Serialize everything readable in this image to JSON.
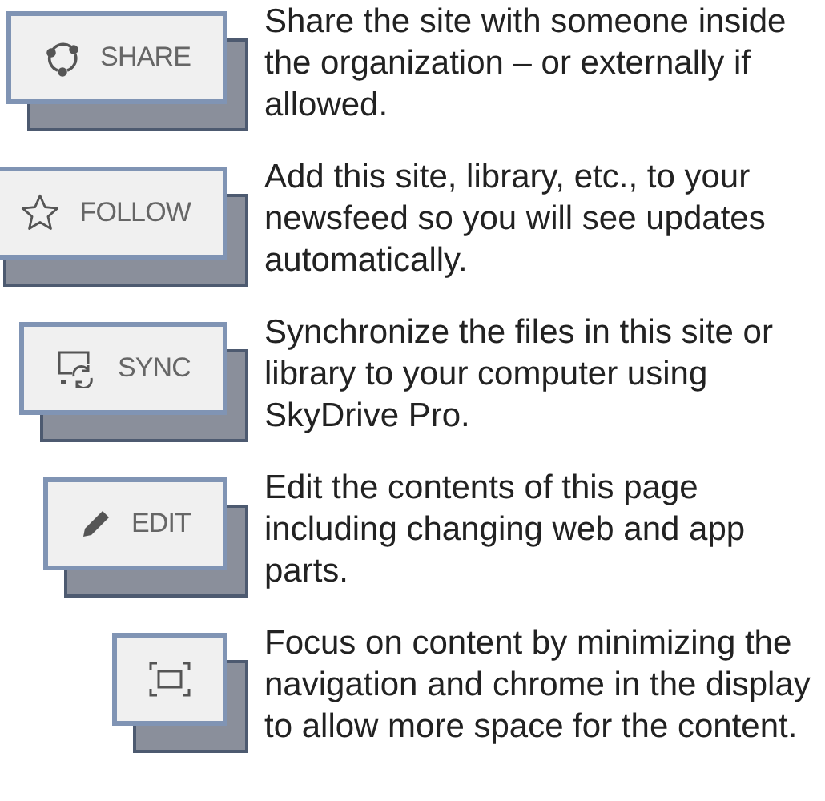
{
  "items": [
    {
      "kind": "share",
      "label": "SHARE",
      "description": "Share the site with someone inside the organization – or externally if allowed."
    },
    {
      "kind": "follow",
      "label": "FOLLOW",
      "description": "Add this site, library, etc., to your newsfeed so you will see updates automatically."
    },
    {
      "kind": "sync",
      "label": "SYNC",
      "description": "Synchronize the files in this site or library to your computer using SkyDrive Pro."
    },
    {
      "kind": "edit",
      "label": "EDIT",
      "description": "Edit the contents of this page including changing web and app parts."
    },
    {
      "kind": "focus",
      "description": "Focus on content by minimizing the navigation and chrome in the display to allow more space for the content."
    }
  ]
}
